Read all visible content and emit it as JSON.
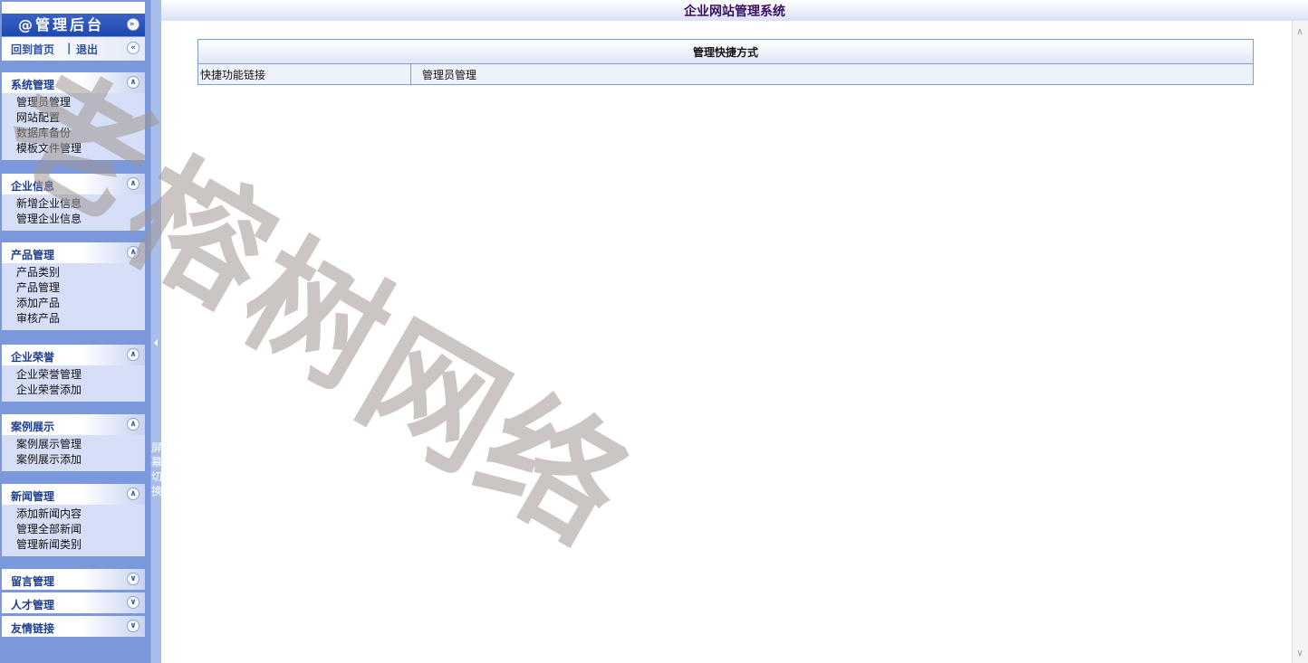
{
  "window": {
    "title": "企业网站管理系统"
  },
  "brand": {
    "title": "@管理后台",
    "toggle_icon": "chevron-double-down"
  },
  "homebar": {
    "home": "回到首页",
    "sep": "|",
    "logout": "退出",
    "collapse_icon": "chevron-double-left"
  },
  "sidebar": {
    "panels": [
      {
        "title": "系统管理",
        "expanded": true,
        "icon": "chevron-double-up",
        "items": [
          "管理员管理",
          "网站配置",
          "数据库备份",
          "模板文件管理"
        ]
      },
      {
        "title": "企业信息",
        "expanded": true,
        "icon": "chevron-double-up",
        "items": [
          "新增企业信息",
          "管理企业信息"
        ]
      },
      {
        "title": "产品管理",
        "expanded": true,
        "icon": "chevron-double-up",
        "items": [
          "产品类别",
          "产品管理",
          "添加产品",
          "审核产品"
        ]
      },
      {
        "title": "企业荣誉",
        "expanded": true,
        "icon": "chevron-double-up",
        "items": [
          "企业荣誉管理",
          "企业荣誉添加"
        ]
      },
      {
        "title": "案例展示",
        "expanded": true,
        "icon": "chevron-double-up",
        "items": [
          "案例展示管理",
          "案例展示添加"
        ]
      },
      {
        "title": "新闻管理",
        "expanded": true,
        "icon": "chevron-double-up",
        "items": [
          "添加新闻内容",
          "管理全部新闻",
          "管理新闻类别"
        ]
      },
      {
        "title": "留言管理",
        "expanded": false,
        "icon": "chevron-double-down",
        "items": []
      },
      {
        "title": "人才管理",
        "expanded": false,
        "icon": "chevron-double-down",
        "items": []
      },
      {
        "title": "友情链接",
        "expanded": false,
        "icon": "chevron-double-down",
        "items": []
      }
    ]
  },
  "splitter": {
    "label": "屏幕切换",
    "arrow_icon": "triangle-left"
  },
  "main": {
    "table_title": "管理快捷方式",
    "row": {
      "label": "快捷功能链接",
      "link": "管理员管理"
    }
  },
  "watermark": {
    "text": "老榕树网络"
  },
  "colors": {
    "sidebar_bg": "#7b98dd",
    "panel_bg": "#d6dff7",
    "title_color": "#3a0e63",
    "border": "#7f9ed8"
  }
}
